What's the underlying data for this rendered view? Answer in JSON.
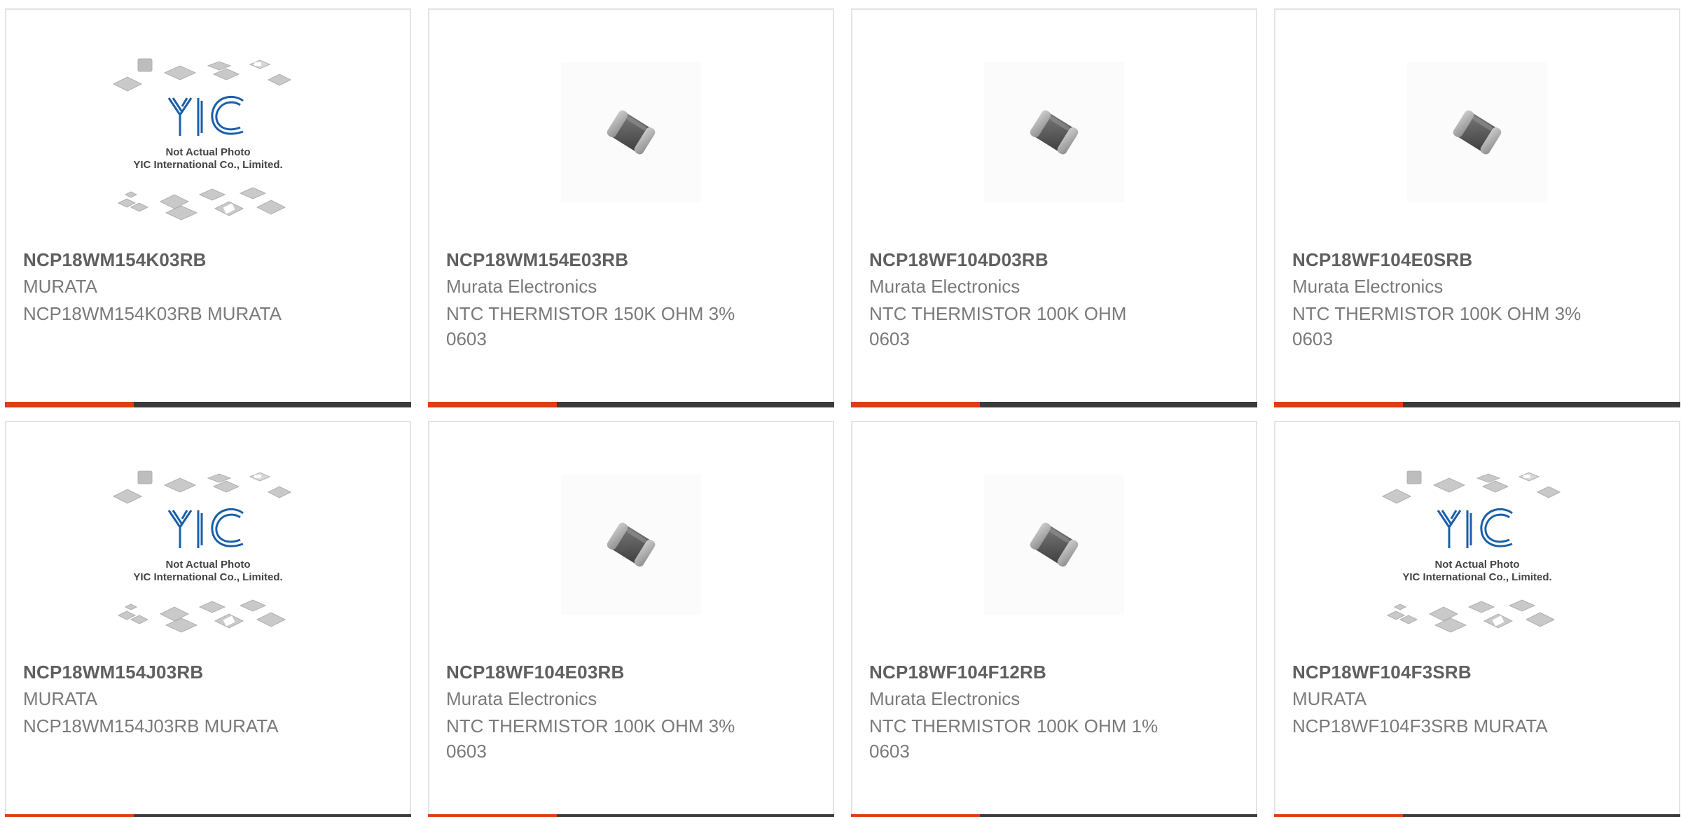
{
  "colors": {
    "accent": "#e03c15",
    "bar_dark": "#3b3b3b",
    "title_text": "#5f5f5f",
    "body_text": "#7a7a7a",
    "logo_blue": "#1a5fa8"
  },
  "placeholder": {
    "line1": "Not Actual Photo",
    "line2": "YIC International Co., Limited.",
    "logo_text": "YIC"
  },
  "products": [
    {
      "part": "NCP18WM154K03RB",
      "maker": "MURATA",
      "desc": "NCP18WM154K03RB MURATA",
      "image": "placeholder-image"
    },
    {
      "part": "NCP18WM154E03RB",
      "maker": "Murata Electronics",
      "desc": "NTC THERMISTOR 150K OHM 3% 0603",
      "image": "chip-image"
    },
    {
      "part": "NCP18WF104D03RB",
      "maker": "Murata Electronics",
      "desc": "NTC THERMISTOR 100K OHM 0603",
      "image": "chip-image"
    },
    {
      "part": "NCP18WF104E0SRB",
      "maker": "Murata Electronics",
      "desc": "NTC THERMISTOR 100K OHM 3% 0603",
      "image": "chip-image"
    },
    {
      "part": "NCP18WM154J03RB",
      "maker": "MURATA",
      "desc": "NCP18WM154J03RB MURATA",
      "image": "placeholder-image"
    },
    {
      "part": "NCP18WF104E03RB",
      "maker": "Murata Electronics",
      "desc": "NTC THERMISTOR 100K OHM 3% 0603",
      "image": "chip-image"
    },
    {
      "part": "NCP18WF104F12RB",
      "maker": "Murata Electronics",
      "desc": "NTC THERMISTOR 100K OHM 1% 0603",
      "image": "chip-image"
    },
    {
      "part": "NCP18WF104F3SRB",
      "maker": "MURATA",
      "desc": "NCP18WF104F3SRB MURATA",
      "image": "placeholder-image"
    }
  ]
}
